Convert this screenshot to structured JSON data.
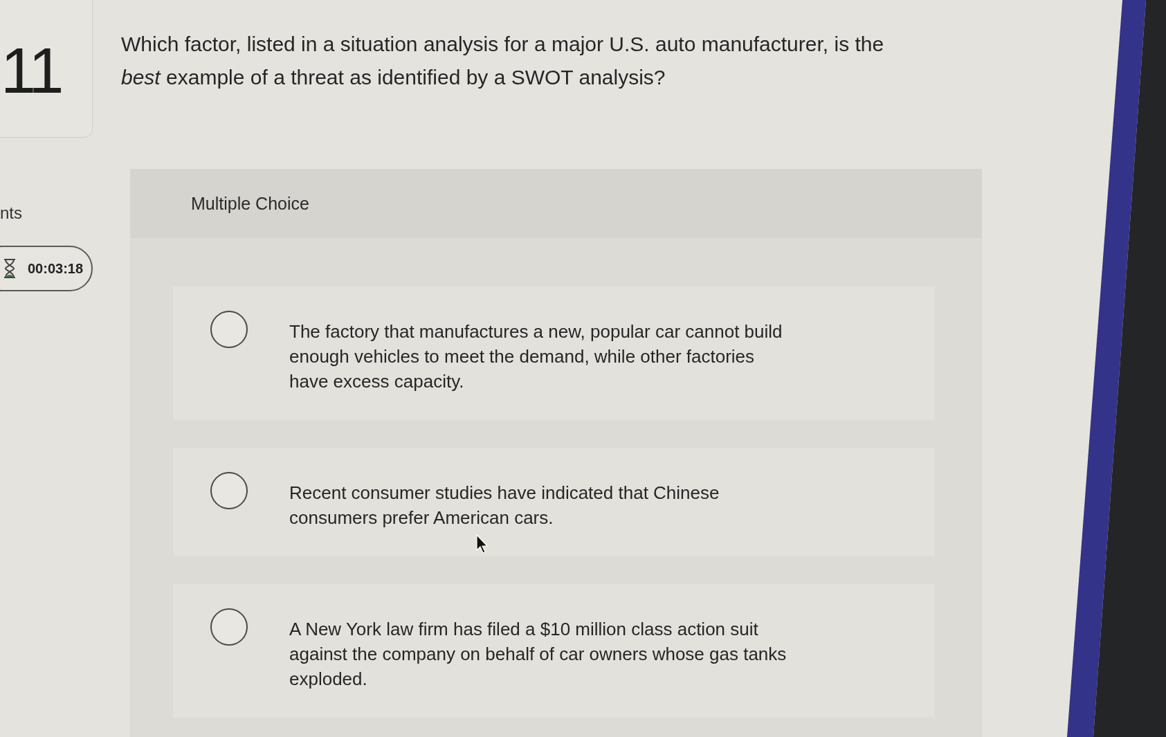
{
  "question_number": "11",
  "points_label": "nts",
  "timer": {
    "time": "00:03:18"
  },
  "question": {
    "text": "Which factor, listed in a situation analysis for a major U.S. auto manufacturer, is the *best* example of a threat as identified by a SWOT analysis?"
  },
  "answer_panel": {
    "heading": "Multiple Choice",
    "options": [
      {
        "text": "The factory that manufactures a new, popular car cannot build enough vehicles to meet the demand, while other factories have excess capacity.",
        "selected": false
      },
      {
        "text": "Recent consumer studies have indicated that Chinese consumers prefer American cars.",
        "selected": false
      },
      {
        "text": "A New York law firm has filed a $10 million class action suit against the company on behalf of car owners whose gas tanks exploded.",
        "selected": false
      }
    ]
  }
}
